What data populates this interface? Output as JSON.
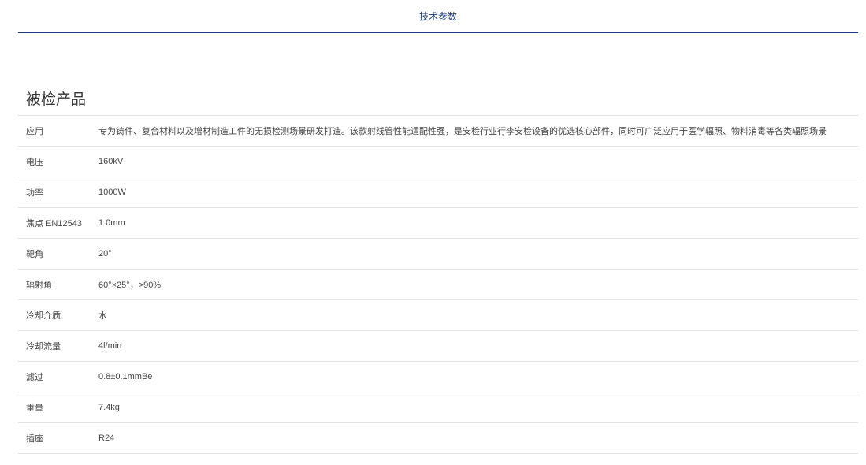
{
  "tabs": [
    {
      "label": "技术参数",
      "active": true
    }
  ],
  "accent_color": "#1a3a7a",
  "section": {
    "title": "被检产品"
  },
  "specs": [
    {
      "label": "应用",
      "value": "专为铸件、复合材料以及增材制造工件的无损检测场景研发打造。该款射线管性能适配性强，是安检行业行李安检设备的优选核心部件，同时可广泛应用于医学辐照、物料消毒等各类辐照场景"
    },
    {
      "label": "电压",
      "value": "160kV"
    },
    {
      "label": "功率",
      "value": "1000W"
    },
    {
      "label": "焦点 EN12543",
      "value": "1.0mm"
    },
    {
      "label": "靶角",
      "value": "20°"
    },
    {
      "label": "辐射角",
      "value": "60°×25°，>90%"
    },
    {
      "label": "冷却介质",
      "value": "水"
    },
    {
      "label": "冷却流量",
      "value": "4l/min"
    },
    {
      "label": "滤过",
      "value": "0.8±0.1mmBe"
    },
    {
      "label": "重量",
      "value": "7.4kg"
    },
    {
      "label": "插座",
      "value": "R24"
    }
  ]
}
